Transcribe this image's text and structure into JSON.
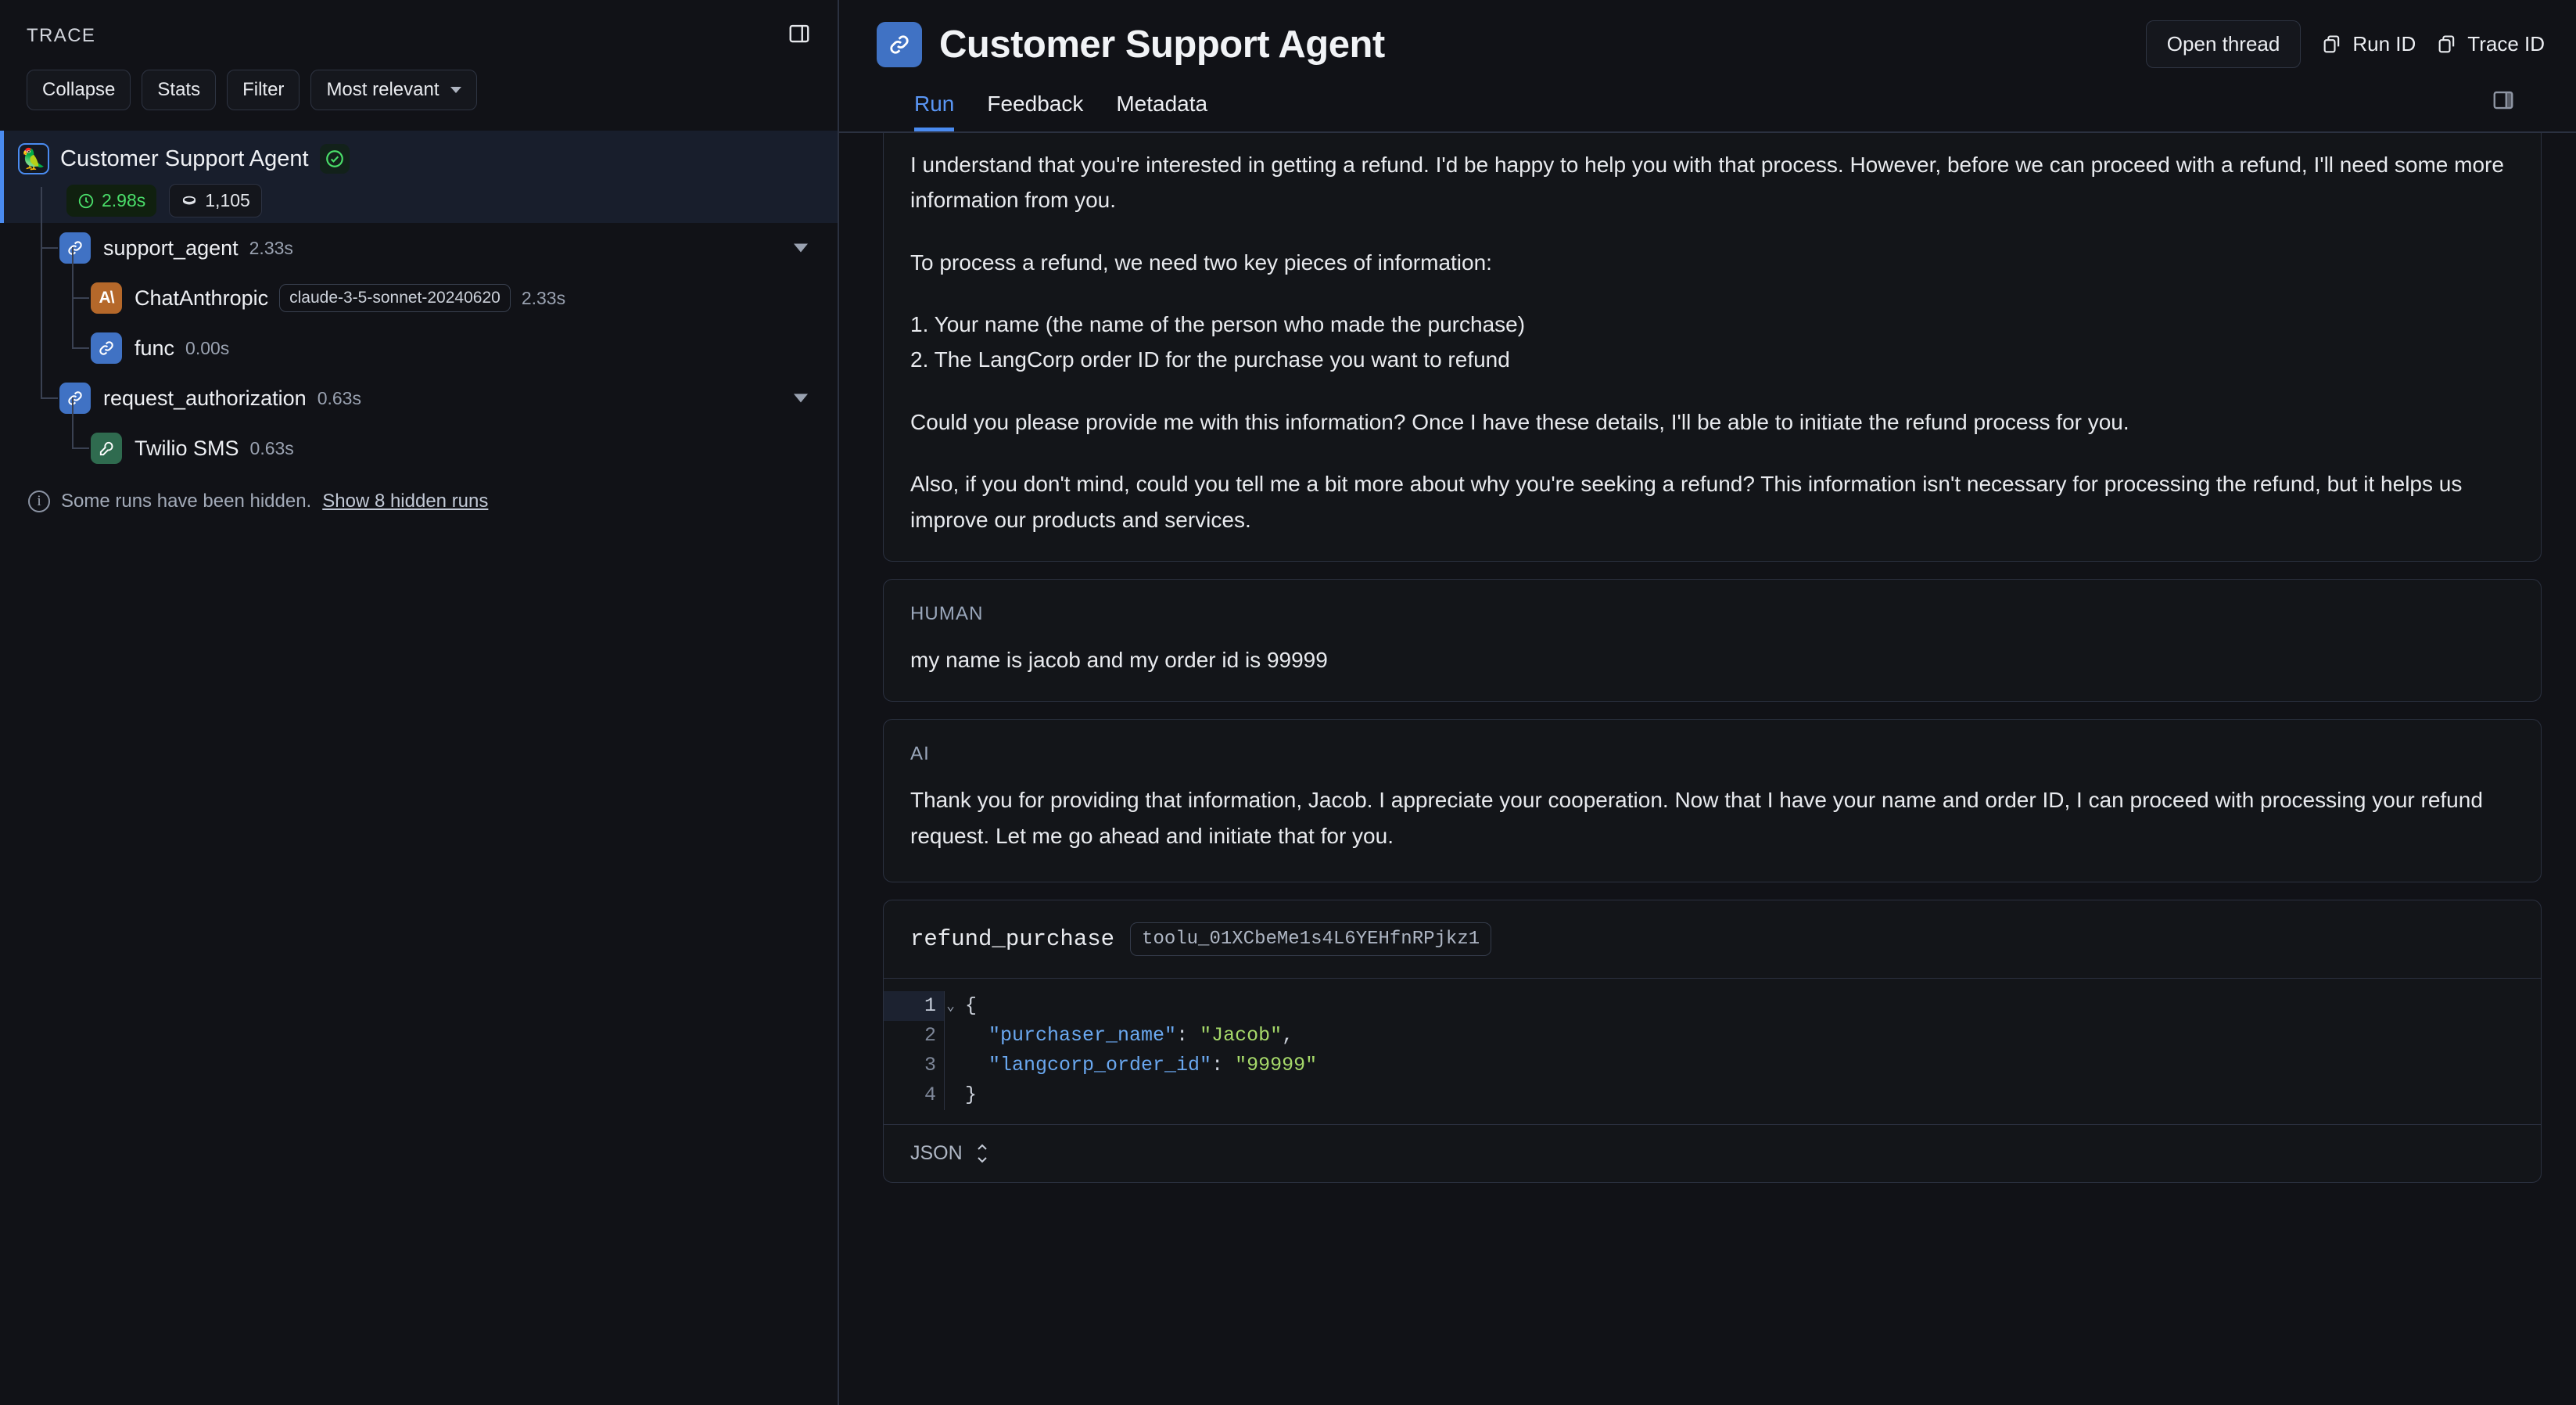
{
  "sidebar": {
    "label": "TRACE",
    "panel_toggle_icon": "panel-collapse-icon",
    "toolbar": {
      "collapse": "Collapse",
      "stats": "Stats",
      "filter": "Filter",
      "sort": "Most relevant"
    },
    "tree": [
      {
        "name": "Customer Support Agent",
        "icon": "parrot-icon",
        "status": "success",
        "duration": "2.98s",
        "tokens": "1,105",
        "depth": 0,
        "selected": true
      },
      {
        "name": "support_agent",
        "icon": "chain-link-icon",
        "duration": "2.33s",
        "depth": 1,
        "expandable": true
      },
      {
        "name": "ChatAnthropic",
        "icon": "anthropic-icon",
        "model": "claude-3-5-sonnet-20240620",
        "duration": "2.33s",
        "depth": 2
      },
      {
        "name": "func",
        "icon": "chain-link-icon",
        "duration": "0.00s",
        "depth": 2
      },
      {
        "name": "request_authorization",
        "icon": "chain-link-icon",
        "duration": "0.63s",
        "depth": 1,
        "expandable": true
      },
      {
        "name": "Twilio SMS",
        "icon": "wrench-icon",
        "duration": "0.63s",
        "depth": 2
      }
    ],
    "hidden_note": {
      "text": "Some runs have been hidden.",
      "link": "Show 8 hidden runs",
      "icon": "info-icon"
    }
  },
  "header": {
    "icon": "chain-link-icon",
    "title": "Customer Support Agent",
    "open_thread": "Open thread",
    "run_id": "Run ID",
    "trace_id": "Trace ID",
    "copy_icon": "copy-icon",
    "panel_toggle_icon": "panel-expand-icon"
  },
  "tabs": [
    {
      "label": "Run",
      "active": true
    },
    {
      "label": "Feedback",
      "active": false
    },
    {
      "label": "Metadata",
      "active": false
    }
  ],
  "messages": {
    "ai_first": {
      "paragraphs": [
        "I understand that you're interested in getting a refund. I'd be happy to help you with that process. However, before we can proceed with a refund, I'll need some more information from you.",
        "To process a refund, we need two key pieces of information:",
        "1. Your name (the name of the person who made the purchase)\n2. The LangCorp order ID for the purchase you want to refund",
        "Could you please provide me with this information? Once I have these details, I'll be able to initiate the refund process for you.",
        "Also, if you don't mind, could you tell me a bit more about why you're seeking a refund? This information isn't necessary for processing the refund, but it helps us improve our products and services."
      ]
    },
    "human": {
      "role": "HUMAN",
      "text": "my name is jacob and my order id is 99999"
    },
    "ai_second": {
      "role": "AI",
      "text": "Thank you for providing that information, Jacob. I appreciate your cooperation. Now that I have your name and order ID, I can proceed with processing your refund request. Let me go ahead and initiate that for you."
    },
    "tool_call": {
      "name": "refund_purchase",
      "id": "toolu_01XCbeMe1s4L6YEHfnRPjkz1",
      "code_lines": [
        {
          "n": "1",
          "text": "{",
          "active": true,
          "foldable": true
        },
        {
          "n": "2",
          "text": "  \"purchaser_name\": \"Jacob\","
        },
        {
          "n": "3",
          "text": "  \"langcorp_order_id\": \"99999\""
        },
        {
          "n": "4",
          "text": "}"
        }
      ],
      "format_label": "JSON"
    }
  },
  "colors": {
    "accent": "#4a8bf0",
    "success": "#4ade6a",
    "bg": "#111217",
    "card_bg": "#131519",
    "border": "#2b3140"
  }
}
